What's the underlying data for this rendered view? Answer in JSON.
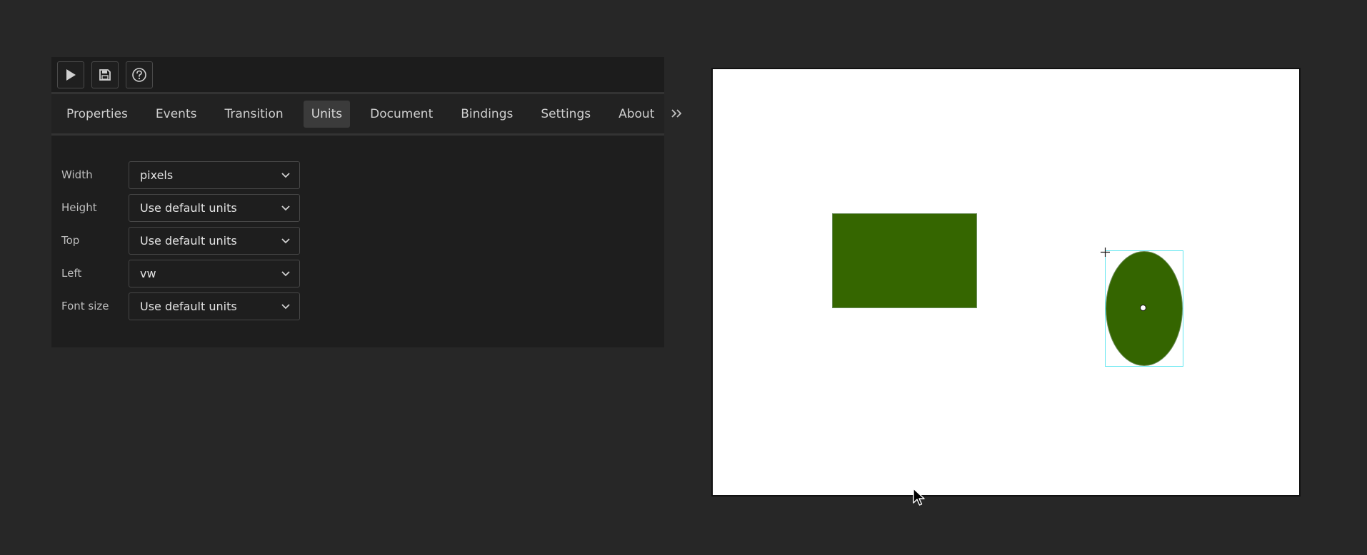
{
  "toolbar": {
    "buttons": [
      {
        "icon": "play-icon"
      },
      {
        "icon": "save-icon"
      },
      {
        "icon": "help-icon"
      }
    ]
  },
  "tabs": {
    "items": [
      "Properties",
      "Events",
      "Transition",
      "Units",
      "Document",
      "Bindings",
      "Settings",
      "About"
    ],
    "active": "Units",
    "more_label": "»"
  },
  "units": {
    "width": {
      "label": "Width",
      "value": "pixels"
    },
    "height": {
      "label": "Height",
      "value": "Use default units"
    },
    "top": {
      "label": "Top",
      "value": "Use default units"
    },
    "left": {
      "label": "Left",
      "value": "vw"
    },
    "font_size": {
      "label": "Font size",
      "value": "Use default units"
    }
  },
  "colors": {
    "shape_fill": "#356600",
    "selection": "#5fe6f0",
    "panel_bg": "#1e1e1e",
    "page_bg": "#272727"
  }
}
